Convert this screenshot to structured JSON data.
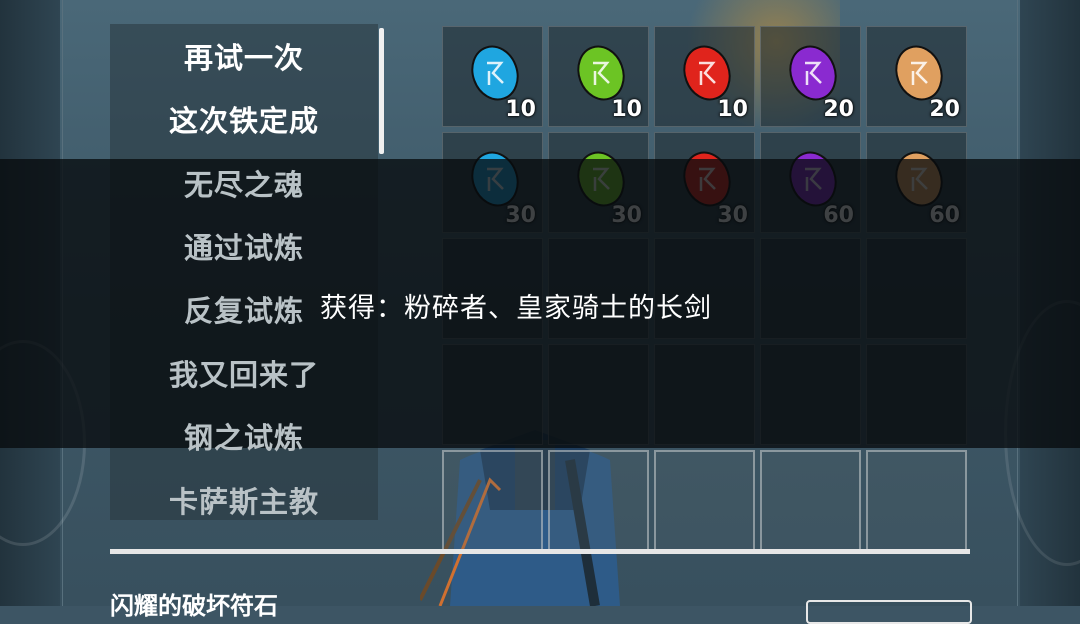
{
  "menu": {
    "items": [
      {
        "label": "再试一次",
        "state": "active"
      },
      {
        "label": "这次铁定成",
        "state": "active"
      },
      {
        "label": "无尽之魂",
        "state": "dim"
      },
      {
        "label": "通过试炼",
        "state": "dim"
      },
      {
        "label": "反复试炼",
        "state": "dim"
      },
      {
        "label": "我又回来了",
        "state": "dim"
      },
      {
        "label": "钢之试炼",
        "state": "dim"
      },
      {
        "label": "卡萨斯主教",
        "state": "dim"
      }
    ]
  },
  "rewards": {
    "rows": [
      [
        {
          "icon": "blue-rune-icon",
          "color": "#1fa6e0",
          "count": "10"
        },
        {
          "icon": "green-rune-icon",
          "color": "#6cc424",
          "count": "10"
        },
        {
          "icon": "red-rune-icon",
          "color": "#e0241c",
          "count": "10"
        },
        {
          "icon": "purple-rune-icon",
          "color": "#8a2ad0",
          "count": "20"
        },
        {
          "icon": "orange-rune-icon",
          "color": "#e0a060",
          "count": "20"
        }
      ],
      [
        {
          "icon": "blue-rune-icon",
          "color": "#1fa6e0",
          "count": "30"
        },
        {
          "icon": "green-rune-icon",
          "color": "#6cc424",
          "count": "30"
        },
        {
          "icon": "red-rune-icon",
          "color": "#e0241c",
          "count": "30"
        },
        {
          "icon": "purple-rune-icon",
          "color": "#8a2ad0",
          "count": "60"
        },
        {
          "icon": "orange-rune-icon",
          "color": "#e0a060",
          "count": "60"
        }
      ]
    ]
  },
  "toast": {
    "message": "获得：粉碎者、皇家骑士的长剑"
  },
  "footer": {
    "item_name": "闪耀的破坏符石"
  }
}
